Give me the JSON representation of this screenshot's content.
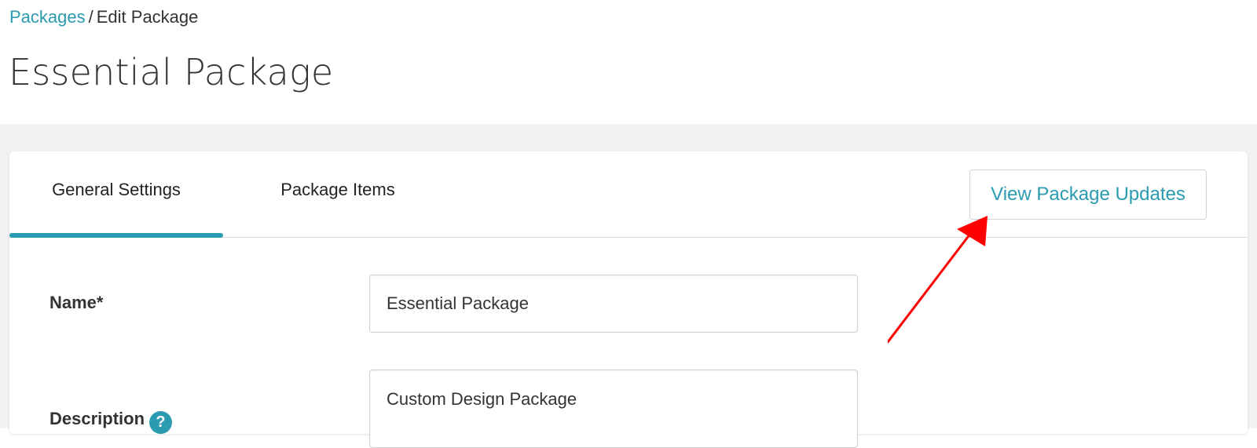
{
  "breadcrumb": {
    "root_label": "Packages",
    "separator": "/",
    "current_label": "Edit Package"
  },
  "page": {
    "title": "Essential Package"
  },
  "tabs": [
    {
      "label": "General Settings",
      "active": true
    },
    {
      "label": "Package Items",
      "active": false
    }
  ],
  "actions": {
    "view_updates_label": "View Package Updates"
  },
  "form": {
    "name_label": "Name*",
    "name_value": "Essential Package",
    "description_label": "Description",
    "description_help_icon": "?",
    "description_value": "Custom Design Package"
  },
  "colors": {
    "accent": "#2a9bb0",
    "annotation_arrow": "#ff0000",
    "page_background": "#f2f2f2"
  },
  "icons": {
    "help": "question-circle-icon",
    "annotation": "red-arrow-icon"
  }
}
